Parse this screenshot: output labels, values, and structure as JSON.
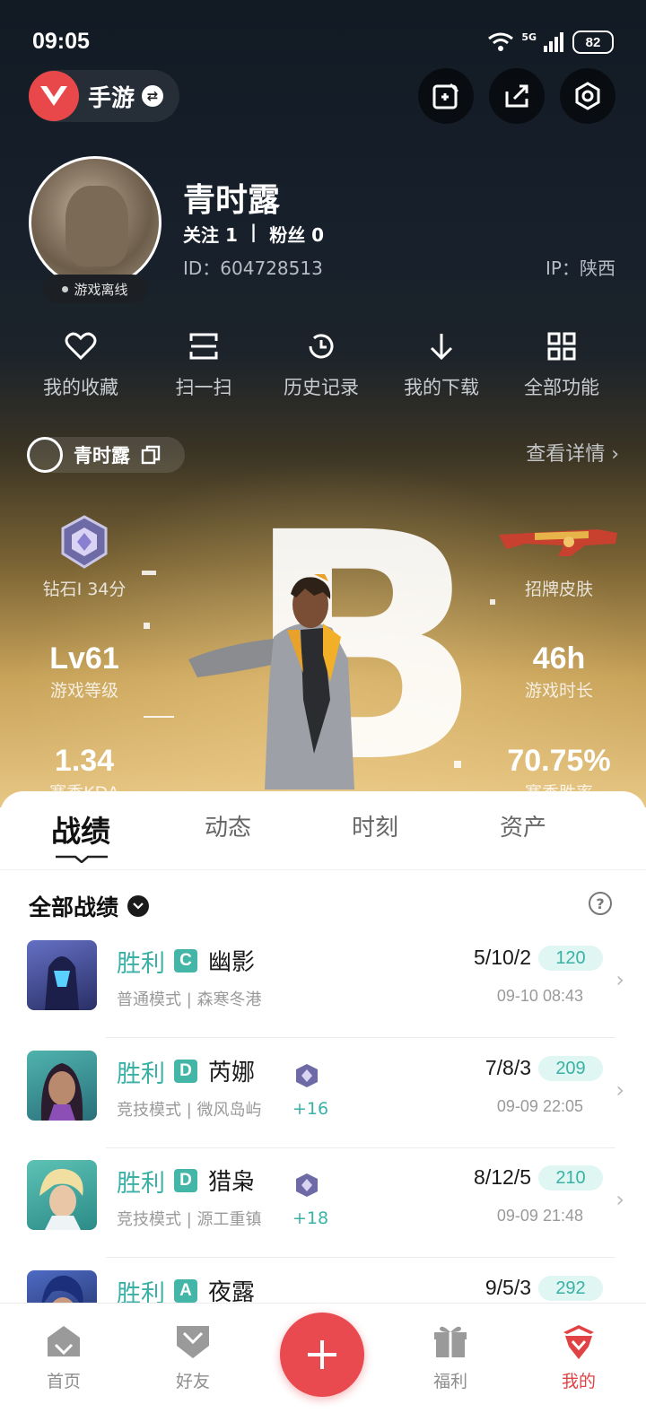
{
  "status_bar": {
    "time": "09:05",
    "network": "5G",
    "battery": "82"
  },
  "header": {
    "game_name": "手游",
    "game_logo": "valorant-logo",
    "buttons": [
      "edit-card-icon",
      "share-icon",
      "settings-icon"
    ]
  },
  "profile": {
    "nickname": "青时露",
    "follow_label": "关注 1",
    "separator": "|",
    "fans_label": "粉丝 0",
    "id_text": "ID：604728513",
    "ip_text": "IP：陕西",
    "status_badge": "游戏离线"
  },
  "quick_actions": [
    {
      "label": "我的收藏",
      "icon": "heart-icon"
    },
    {
      "label": "扫一扫",
      "icon": "scan-icon"
    },
    {
      "label": "历史记录",
      "icon": "history-icon"
    },
    {
      "label": "我的下载",
      "icon": "download-icon"
    },
    {
      "label": "全部功能",
      "icon": "grid-icon"
    }
  ],
  "game_card": {
    "role_name": "青时露",
    "detail_link": "查看详情 ›",
    "big_letter": "B",
    "stats": {
      "rank": {
        "value": "",
        "label": "钻石I 34分"
      },
      "skin": {
        "value": "",
        "label": "招牌皮肤"
      },
      "level": {
        "value": "Lv61",
        "label": "游戏等级"
      },
      "hours": {
        "value": "46h",
        "label": "游戏时长"
      },
      "kda": {
        "value": "1.34",
        "label": "赛季KDA"
      },
      "winrate": {
        "value": "70.75%",
        "label": "赛季胜率"
      }
    }
  },
  "tabs": [
    "战绩",
    "动态",
    "时刻",
    "资产"
  ],
  "active_tab": "战绩",
  "filter": {
    "label": "全部战绩",
    "help": "?"
  },
  "matches": [
    {
      "result": "胜利",
      "grade": "C",
      "agent": "幽影",
      "mode": "普通模式 | 森寒冬港",
      "kda": "5/10/2",
      "score": "120",
      "time": "09-10 08:43",
      "rank_delta": "",
      "thumb_color": "#3a3f8f"
    },
    {
      "result": "胜利",
      "grade": "D",
      "agent": "芮娜",
      "mode": "竞技模式 | 微风岛屿",
      "kda": "7/8/3",
      "score": "209",
      "time": "09-09 22:05",
      "rank_delta": "+16",
      "thumb_color": "#2f8d8a"
    },
    {
      "result": "胜利",
      "grade": "D",
      "agent": "猎枭",
      "mode": "竞技模式 | 源工重镇",
      "kda": "8/12/5",
      "score": "210",
      "time": "09-09 21:48",
      "rank_delta": "+18",
      "thumb_color": "#3b9c95"
    },
    {
      "result": "胜利",
      "grade": "A",
      "agent": "夜露",
      "mode": "",
      "kda": "9/5/3",
      "score": "292",
      "time": "",
      "rank_delta": "",
      "thumb_color": "#3b4d8f"
    }
  ],
  "bottom_nav": [
    {
      "label": "首页",
      "icon": "home-icon",
      "active": false
    },
    {
      "label": "好友",
      "icon": "friends-icon",
      "active": false
    },
    {
      "label": "",
      "icon": "plus-icon",
      "active": false
    },
    {
      "label": "福利",
      "icon": "gift-icon",
      "active": false
    },
    {
      "label": "我的",
      "icon": "profile-icon",
      "active": true
    }
  ],
  "colors": {
    "accent": "#e84a50",
    "win": "#3bb1a6",
    "score_bg": "#dff6f2"
  }
}
